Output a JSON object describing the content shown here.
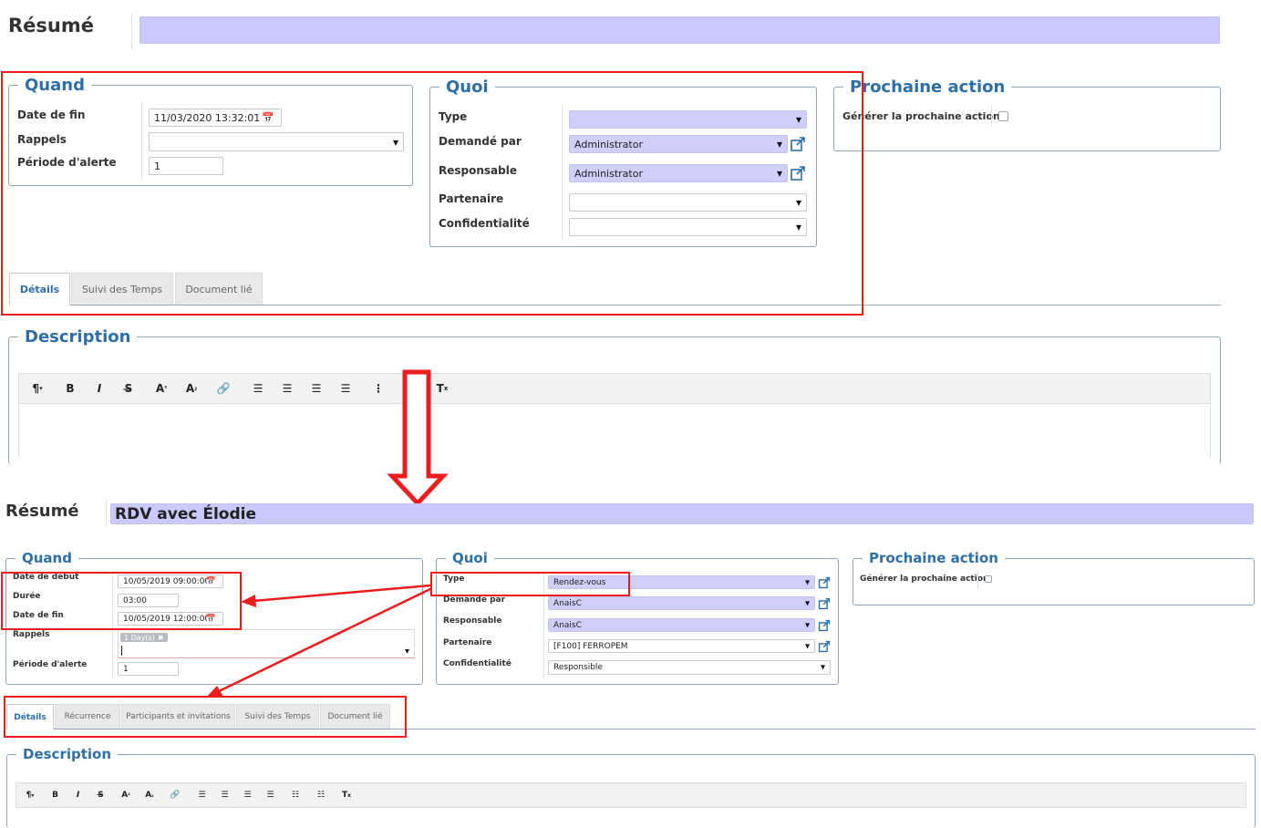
{
  "top": {
    "summary_label": "Résumé",
    "summary_value": "",
    "when": {
      "legend": "Quand",
      "end_date_label": "Date de fin",
      "end_date_value": "11/03/2020 13:32:01",
      "reminders_label": "Rappels",
      "reminders_value": "",
      "alert_label": "Période d'alerte",
      "alert_value": "1"
    },
    "what": {
      "legend": "Quoi",
      "type_label": "Type",
      "type_value": "",
      "requested_label": "Demandé par",
      "requested_value": "Administrator",
      "responsible_label": "Responsable",
      "responsible_value": "Administrator",
      "partner_label": "Partenaire",
      "partner_value": "",
      "confidentiality_label": "Confidentialité",
      "confidentiality_value": ""
    },
    "next": {
      "legend": "Prochaine action",
      "generate_label": "Générer la prochaine action"
    },
    "tabs": [
      "Détails",
      "Suivi des Temps",
      "Document lié"
    ],
    "description_legend": "Description"
  },
  "bottom": {
    "summary_label": "Résumé",
    "summary_value": "RDV avec Élodie",
    "when": {
      "legend": "Quand",
      "start_date_label": "Date de début",
      "start_date_value": "10/05/2019 09:00:00",
      "duration_label": "Durée",
      "duration_value": "03:00",
      "end_date_label": "Date de fin",
      "end_date_value": "10/05/2019 12:00:00",
      "reminders_label": "Rappels",
      "reminder_tag": "1 Day(s)",
      "alert_label": "Période d'alerte",
      "alert_value": "1"
    },
    "what": {
      "legend": "Quoi",
      "type_label": "Type",
      "type_value": "Rendez-vous",
      "requested_label": "Demandé par",
      "requested_value": "AnaisC",
      "responsible_label": "Responsable",
      "responsible_value": "AnaisC",
      "partner_label": "Partenaire",
      "partner_value": "[F100] FERROPEM",
      "confidentiality_label": "Confidentialité",
      "confidentiality_value": "Responsible"
    },
    "next": {
      "legend": "Prochaine action",
      "generate_label": "Générer la prochaine action"
    },
    "tabs": [
      "Détails",
      "Récurrence",
      "Participants et invitations",
      "Suivi des Temps",
      "Document lié"
    ],
    "description_legend": "Description"
  },
  "icons": {
    "caret": "▾",
    "calendar": "📅",
    "external_link": "external-link-icon",
    "tag_remove": "✖"
  },
  "colors": {
    "accent": "#2e6fa8",
    "many2one_bg": "#cfcffa",
    "highlight": "#ee1c1c",
    "tab_active": "#ffffff",
    "tab_inactive": "#e9e9e9"
  }
}
